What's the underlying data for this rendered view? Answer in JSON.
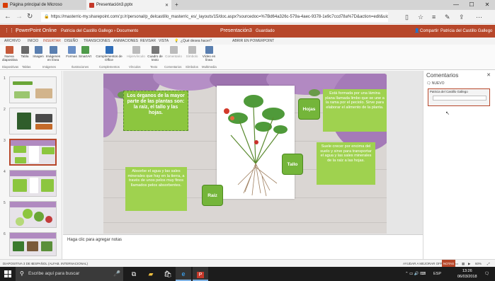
{
  "browser": {
    "tabs": [
      {
        "title": "Página principal de Microso",
        "active": false
      },
      {
        "title": "Presentación3.pptx",
        "active": true
      }
    ],
    "url": "https://masterric-my.sharepoint.com/:p:/r/personal/p_delcastillo_masterric_es/_layouts/15/doc.aspx?sourcedoc=%7Bd64a326c-579a-4aec-9378-1e9c7ccd78a%7D&action=edit&uid",
    "window_controls": [
      "—",
      "☐",
      "✕"
    ]
  },
  "office_header": {
    "app_name": "PowerPoint Online",
    "breadcrumb": "Patricia del Castillo Gallego  ›  Documento",
    "doc_title": "Presentación3",
    "save_status": "Guardado",
    "share_label": "Compartir",
    "user_name": "Patricia del Castillo Gallego"
  },
  "ribbon_tabs": [
    {
      "label": "ARCHIVO"
    },
    {
      "label": "INICIO"
    },
    {
      "label": "INSERTAR",
      "selected": true
    },
    {
      "label": "DISEÑO"
    },
    {
      "label": "TRANSICIONES"
    },
    {
      "label": "ANIMACIONES"
    },
    {
      "label": "REVISAR"
    },
    {
      "label": "VISTA"
    },
    {
      "label": "¿Qué desea hacer?"
    },
    {
      "label": "ABRIR EN POWERPOINT"
    }
  ],
  "ribbon_buttons": [
    {
      "label": "Nueva diapositiva",
      "icon": "new-slide-icon",
      "color": "#c55a3a"
    },
    {
      "label": "Tabla",
      "icon": "table-icon",
      "color": "#6a6a6a"
    },
    {
      "label": "Imagen",
      "icon": "image-icon",
      "color": "#5a7fb0"
    },
    {
      "label": "Imágenes en línea",
      "icon": "online-image-icon",
      "color": "#5a7fb0"
    },
    {
      "label": "Formas",
      "icon": "shapes-icon",
      "color": "#6a8fc6"
    },
    {
      "label": "SmartArt",
      "icon": "smartart-icon",
      "color": "#4f9b4a"
    },
    {
      "label": "Complementos de Office",
      "icon": "addins-icon",
      "color": "#2f6db8"
    },
    {
      "label": "Hipervínculo",
      "icon": "hyperlink-icon",
      "color": "#aaaaaa"
    },
    {
      "label": "Cuadro de texto",
      "icon": "textbox-icon",
      "color": "#777777"
    },
    {
      "label": "Comentario",
      "icon": "comment-icon",
      "color": "#aaaaaa"
    },
    {
      "label": "Símbolo",
      "icon": "symbol-icon",
      "color": "#aaaaaa"
    },
    {
      "label": "Vídeo en línea",
      "icon": "video-icon",
      "color": "#5a7fb0"
    }
  ],
  "ribbon_groups": [
    "Diapositivas",
    "Tablas",
    "Imágenes",
    "Ilustraciones",
    "Complementos",
    "Vínculos",
    "Texto",
    "Comentarios",
    "Símbolos",
    "Multimedia"
  ],
  "slide_numbers": [
    "1",
    "2",
    "3",
    "4",
    "5",
    "6"
  ],
  "slide": {
    "title_box": "Los órganos de la mayor parte de las plantas son: la raíz, el tallo y las hojas.",
    "hojas_desc": "Está formada por una lámina plana llamada limbo que se une a la rama por el peciolo. Sirve para elaborar el alimento de la planta.",
    "tallo_desc": "Suele crecer por encima del suelo y sirve para transportar el agua y las sales minerales de la raíz a las hojas.",
    "raiz_desc": "Absorbe el agua y las sales minerales que hay en la tierra, a través de unos pelos muy finos llamados pelos absorbentes.",
    "label_hojas": "Hojas",
    "label_tallo": "Tallo",
    "label_raiz": "Raíz"
  },
  "notes_placeholder": "Haga clic para agregar notas",
  "comments_panel": {
    "title": "Comentarios",
    "close": "✕",
    "new_label": "NUEVO",
    "author": "Patricia del Castillo Gallego"
  },
  "status_bar": {
    "slide_info": "DIAPOSITIVA 3 DE 6",
    "language": "ESPAÑOL (ALFAB. INTERNACIONAL)",
    "help": "AYUDAR A MEJORAR OFFICE",
    "notes": "NOTAS",
    "zoom": "60%"
  },
  "taskbar": {
    "search_placeholder": "Escribe aquí para buscar",
    "lang": "ESP",
    "time": "13:26",
    "date": "06/03/2018"
  }
}
